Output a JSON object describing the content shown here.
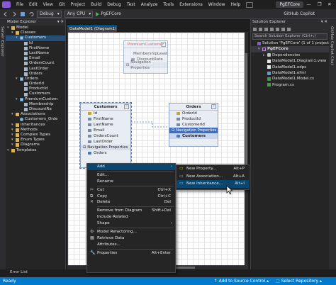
{
  "menubar": {
    "items": [
      "File",
      "Edit",
      "View",
      "Git",
      "Project",
      "Build",
      "Debug",
      "Test",
      "Analyze",
      "Tools",
      "Extensions",
      "Window",
      "Help"
    ],
    "project_badge": "PgEFCore",
    "window_controls": [
      "—",
      "❐",
      "✕"
    ]
  },
  "toolbar": {
    "config": "Debug",
    "platform": "Any CPU",
    "start_label": "PgEFCore",
    "copilot": "GitHub Copilot"
  },
  "left_strip": {
    "label": "Server Explorer"
  },
  "right_strip": {
    "label": "GitHub Copilot Chat"
  },
  "model_explorer": {
    "title": "Model Explorer",
    "rows": [
      {
        "label": "Model",
        "indent": 0,
        "icon": "folder"
      },
      {
        "label": "Classes",
        "indent": 1,
        "icon": "folder"
      },
      {
        "label": "Customers",
        "indent": 2,
        "icon": "entity",
        "selected": true
      },
      {
        "label": "Id",
        "indent": 3,
        "icon": "prop"
      },
      {
        "label": "FirstName",
        "indent": 3,
        "icon": "prop"
      },
      {
        "label": "LastName",
        "indent": 3,
        "icon": "prop"
      },
      {
        "label": "Email",
        "indent": 3,
        "icon": "prop"
      },
      {
        "label": "OrdersCount",
        "indent": 3,
        "icon": "prop"
      },
      {
        "label": "LastOrder",
        "indent": 3,
        "icon": "prop"
      },
      {
        "label": "Orders",
        "indent": 3,
        "icon": "prop"
      },
      {
        "label": "Orders",
        "indent": 2,
        "icon": "entity"
      },
      {
        "label": "OrderId",
        "indent": 3,
        "icon": "prop"
      },
      {
        "label": "ProductId",
        "indent": 3,
        "icon": "prop"
      },
      {
        "label": "Customers",
        "indent": 3,
        "icon": "prop"
      },
      {
        "label": "PremiumCustom",
        "indent": 2,
        "icon": "entity"
      },
      {
        "label": "Membership",
        "indent": 3,
        "icon": "prop"
      },
      {
        "label": "DiscountRa",
        "indent": 3,
        "icon": "prop"
      },
      {
        "label": "Associations",
        "indent": 1,
        "icon": "folder"
      },
      {
        "label": "Customers_Orde",
        "indent": 2,
        "icon": "assoc"
      },
      {
        "label": "Inheritances",
        "indent": 1,
        "icon": "folder"
      },
      {
        "label": "Methods",
        "indent": 1,
        "icon": "folder"
      },
      {
        "label": "Complex Types",
        "indent": 1,
        "icon": "folder"
      },
      {
        "label": "Enum Types",
        "indent": 1,
        "icon": "folder"
      },
      {
        "label": "Diagrams",
        "indent": 1,
        "icon": "folder"
      },
      {
        "label": "Templates",
        "indent": 0,
        "icon": "folder"
      }
    ]
  },
  "document_tab": "DataModel1 (Diagram1)",
  "diagram": {
    "premium": {
      "title": "PremiumCustomer",
      "props": [
        "MembershipLevel",
        "DiscountRate"
      ],
      "nav_section": "Navigation Properties"
    },
    "customers": {
      "title": "Customers",
      "props": [
        "Id",
        "FirstName",
        "LastName",
        "Email",
        "OrdersCount",
        "LastOrder"
      ],
      "nav_section": "Navigation Properties",
      "nav_props": [
        "Orders"
      ]
    },
    "orders": {
      "title": "Orders",
      "props": [
        "OrderId",
        "ProductId",
        "CustomerId"
      ],
      "nav_section": "Navigation Properties",
      "nav_props": [
        "Customers"
      ]
    }
  },
  "context_menu": {
    "items": [
      {
        "label": "Add",
        "shortcut": "",
        "submenu": true,
        "highlight": true,
        "icon": ""
      },
      {
        "sep": true
      },
      {
        "label": "Edit...",
        "shortcut": "",
        "icon": ""
      },
      {
        "label": "Rename",
        "shortcut": "",
        "icon": ""
      },
      {
        "sep": true
      },
      {
        "label": "Cut",
        "shortcut": "Ctrl+X",
        "icon": "✂"
      },
      {
        "label": "Copy",
        "shortcut": "Ctrl+C",
        "icon": "⧉"
      },
      {
        "label": "Delete",
        "shortcut": "Del",
        "icon": "✕"
      },
      {
        "sep": true
      },
      {
        "label": "Remove from Diagram",
        "shortcut": "Shift+Del",
        "icon": ""
      },
      {
        "label": "Include Related",
        "shortcut": "",
        "icon": ""
      },
      {
        "label": "Shape",
        "shortcut": "",
        "submenu": true,
        "icon": ""
      },
      {
        "sep": true
      },
      {
        "label": "Model Refactoring...",
        "shortcut": "",
        "icon": "⚙"
      },
      {
        "label": "Retrieve Data",
        "shortcut": "",
        "icon": "▦"
      },
      {
        "label": "Attributes...",
        "shortcut": "",
        "icon": ""
      },
      {
        "sep": true
      },
      {
        "label": "Properties",
        "shortcut": "Alt+Enter",
        "icon": "🔧"
      }
    ]
  },
  "sub_menu": {
    "items": [
      {
        "label": "New Property...",
        "shortcut": "Alt+P"
      },
      {
        "label": "New Association...",
        "shortcut": "Alt+A"
      },
      {
        "label": "New Inheritance...",
        "shortcut": "Alt+I",
        "highlight": true
      }
    ]
  },
  "solution_explorer": {
    "title": "Solution Explorer",
    "search_placeholder": "Search Solution Explorer (Ctrl+;)",
    "rows": [
      {
        "label": "Solution 'PgEFCore' (1 of 1 project)",
        "indent": 0,
        "icon": "sln"
      },
      {
        "label": "PgEFCore",
        "indent": 1,
        "icon": "proj",
        "selected": true
      },
      {
        "label": "Dependencies",
        "indent": 2,
        "icon": "dep"
      },
      {
        "label": "DataModel1.Diagram1.view",
        "indent": 2,
        "icon": "file"
      },
      {
        "label": "DataModel1.edps",
        "indent": 2,
        "icon": "file"
      },
      {
        "label": "DataModel1.efml",
        "indent": 2,
        "icon": "edmx"
      },
      {
        "label": "DataModel1.Model.cs",
        "indent": 2,
        "icon": "cs"
      },
      {
        "label": "Program.cs",
        "indent": 2,
        "icon": "cs"
      }
    ]
  },
  "error_tab": "Error List",
  "status": {
    "ready": "Ready",
    "source_control": "↑ Add to Source Control ▴",
    "repo": "⬚ Select Repository ▴"
  }
}
